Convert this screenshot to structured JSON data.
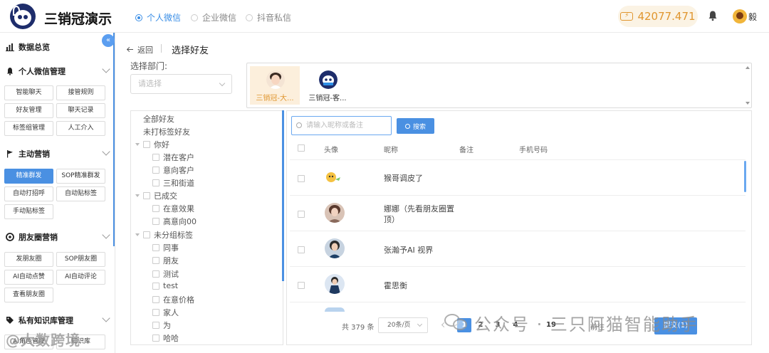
{
  "header": {
    "app_title": "三销冠演示",
    "tabs": [
      {
        "label": "个人微信",
        "selected": true
      },
      {
        "label": "企业微信",
        "selected": false
      },
      {
        "label": "抖音私信",
        "selected": false
      }
    ],
    "balance": "42077.471",
    "user_name": "毅"
  },
  "sidebar": {
    "collapse_icon": "«",
    "sections": [
      {
        "title": "数据总览",
        "icon": "bar-chart-icon",
        "items": []
      },
      {
        "title": "个人微信管理",
        "icon": "bell-icon",
        "items": [
          "智能聊天",
          "接管规则",
          "好友管理",
          "聊天记录",
          "标签组管理",
          "人工介入"
        ]
      },
      {
        "title": "主动营销",
        "icon": "flag-icon",
        "items": [
          "精准群发",
          "SOP精准群发",
          "自动打招呼",
          "自动贴标签",
          "手动贴标签"
        ]
      },
      {
        "title": "朋友圈营销",
        "icon": "aperture-icon",
        "items": [
          "发朋友圈",
          "SOP朋友圈",
          "AI自动点赞",
          "AI自动评论",
          "查看朋友圈"
        ]
      },
      {
        "title": "私有知识库管理",
        "icon": "tags-icon",
        "items": [
          "AI角色管理",
          "知识库"
        ]
      }
    ],
    "active_item": "精准群发"
  },
  "main": {
    "back_label": "返回",
    "page_title": "选择好友",
    "dept_label": "选择部门:",
    "dept_placeholder": "请选择",
    "accounts": [
      {
        "name": "三销冠-大...",
        "selected": true
      },
      {
        "name": "三销冠-客...",
        "selected": false
      }
    ],
    "tree": [
      {
        "label": "全部好友",
        "level": 0,
        "checkbox": false,
        "expander": false
      },
      {
        "label": "未打标签好友",
        "level": 0,
        "checkbox": false,
        "expander": false
      },
      {
        "label": "你好",
        "level": 0,
        "checkbox": true,
        "expander": true
      },
      {
        "label": "潜在客户",
        "level": 1,
        "checkbox": true,
        "expander": false
      },
      {
        "label": "意向客户",
        "level": 1,
        "checkbox": true,
        "expander": false
      },
      {
        "label": "三和街道",
        "level": 1,
        "checkbox": true,
        "expander": false
      },
      {
        "label": "已成交",
        "level": 0,
        "checkbox": true,
        "expander": true
      },
      {
        "label": "在意效果",
        "level": 1,
        "checkbox": true,
        "expander": false
      },
      {
        "label": "高意向00",
        "level": 1,
        "checkbox": true,
        "expander": false
      },
      {
        "label": "未分组标签",
        "level": 0,
        "checkbox": true,
        "expander": true
      },
      {
        "label": "同事",
        "level": 1,
        "checkbox": true,
        "expander": false
      },
      {
        "label": "朋友",
        "level": 1,
        "checkbox": true,
        "expander": false
      },
      {
        "label": "测试",
        "level": 1,
        "checkbox": true,
        "expander": false
      },
      {
        "label": "test",
        "level": 1,
        "checkbox": true,
        "expander": false
      },
      {
        "label": "在意价格",
        "level": 1,
        "checkbox": true,
        "expander": false
      },
      {
        "label": "家人",
        "level": 1,
        "checkbox": true,
        "expander": false
      },
      {
        "label": "为",
        "level": 1,
        "checkbox": true,
        "expander": false
      },
      {
        "label": "哈哈",
        "level": 1,
        "checkbox": true,
        "expander": false
      }
    ],
    "search_placeholder": "请输入昵称或备注",
    "search_button": "搜索",
    "columns": [
      "头像",
      "昵称",
      "备注",
      "手机号码"
    ],
    "rows": [
      {
        "nickname": "猴哥调皮了",
        "avatar_color": "#f5c242"
      },
      {
        "nickname": "娜娜（先看朋友圈置顶）",
        "avatar_color": "#c9a38f"
      },
      {
        "nickname": "张瀚予AI 视界",
        "avatar_color": "#3d5a80"
      },
      {
        "nickname": "霍思衡",
        "avatar_color": "#2b4c7e"
      }
    ],
    "pagination": {
      "total": "共 379 条",
      "page_size": "20条/页",
      "pages": [
        "1",
        "2",
        "3",
        "4",
        "19"
      ],
      "current": "1",
      "goto_label": "前往"
    },
    "submit_label": "提交(1)"
  },
  "watermarks": {
    "right": "公众号 · 三只阿猫智能助手",
    "left": "@大数跨境"
  },
  "colors": {
    "accent": "#4a90e2",
    "balance": "#e0962f",
    "selected_account_bg": "#fcefdc"
  }
}
